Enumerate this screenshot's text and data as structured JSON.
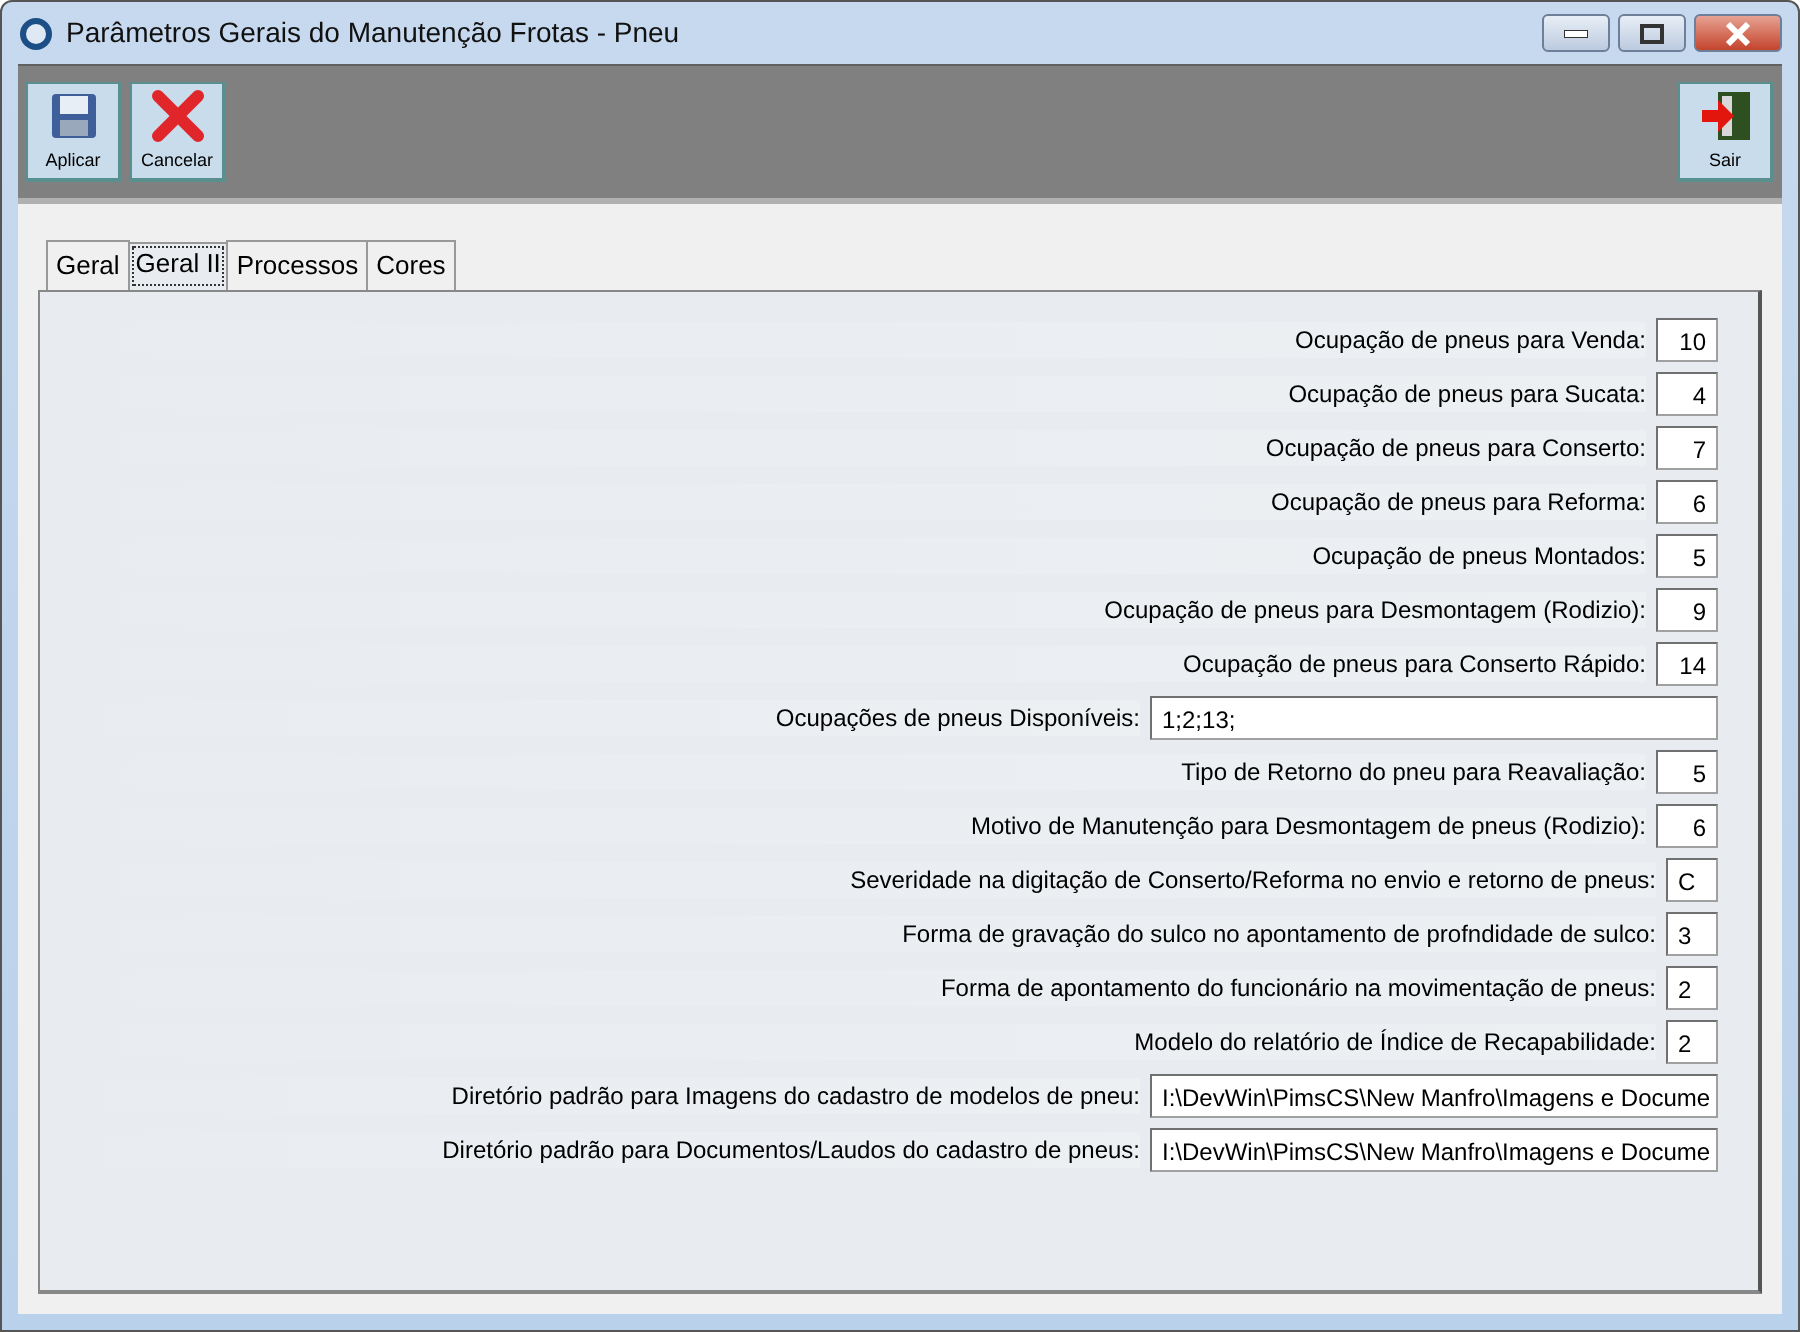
{
  "window": {
    "title": "Parâmetros Gerais do Manutenção Frotas - Pneu"
  },
  "toolbar": {
    "left": [
      {
        "label": "Aplicar",
        "kind": "save"
      },
      {
        "label": "Cancelar",
        "kind": "cancel"
      }
    ],
    "right": [
      {
        "label": "Sair",
        "kind": "exit"
      }
    ]
  },
  "tabs": [
    {
      "label": "Geral",
      "selected": false
    },
    {
      "label": "Geral II",
      "selected": true
    },
    {
      "label": "Processos",
      "selected": false
    },
    {
      "label": "Cores",
      "selected": false
    }
  ],
  "fields": [
    {
      "label": "Ocupação de pneus para Venda:",
      "value": "10",
      "kind": "number"
    },
    {
      "label": "Ocupação de pneus para Sucata:",
      "value": "4",
      "kind": "number"
    },
    {
      "label": "Ocupação de pneus para Conserto:",
      "value": "7",
      "kind": "number"
    },
    {
      "label": "Ocupação de pneus para Reforma:",
      "value": "6",
      "kind": "number"
    },
    {
      "label": "Ocupação de pneus Montados:",
      "value": "5",
      "kind": "number"
    },
    {
      "label": "Ocupação de pneus para Desmontagem (Rodizio):",
      "value": "9",
      "kind": "number"
    },
    {
      "label": "Ocupação de pneus para Conserto Rápido:",
      "value": "14",
      "kind": "number"
    },
    {
      "label": "Ocupações de pneus Disponíveis:",
      "value": "1;2;13;",
      "kind": "text"
    },
    {
      "label": "Tipo de Retorno do pneu para Reavaliação:",
      "value": "5",
      "kind": "number"
    },
    {
      "label": "Motivo de Manutenção para Desmontagem de pneus (Rodizio):",
      "value": "6",
      "kind": "number"
    },
    {
      "label": "Severidade na digitação de Conserto/Reforma no envio e retorno de pneus:",
      "value": "C",
      "kind": "code"
    },
    {
      "label": "Forma de gravação do sulco no apontamento de profndidade de sulco:",
      "value": "3",
      "kind": "code"
    },
    {
      "label": "Forma de apontamento do funcionário na movimentação de pneus:",
      "value": "2",
      "kind": "code"
    },
    {
      "label": "Modelo do relatório de Índice de Recapabilidade:",
      "value": "2",
      "kind": "code"
    },
    {
      "label": "Diretório padrão para Imagens do cadastro de modelos de pneu:",
      "value": "I:\\DevWin\\PimsCS\\New Manfro\\Imagens e Docume",
      "kind": "text"
    },
    {
      "label": "Diretório padrão para Documentos/Laudos do cadastro de pneus:",
      "value": "I:\\DevWin\\PimsCS\\New Manfro\\Imagens e Docume",
      "kind": "text"
    }
  ]
}
